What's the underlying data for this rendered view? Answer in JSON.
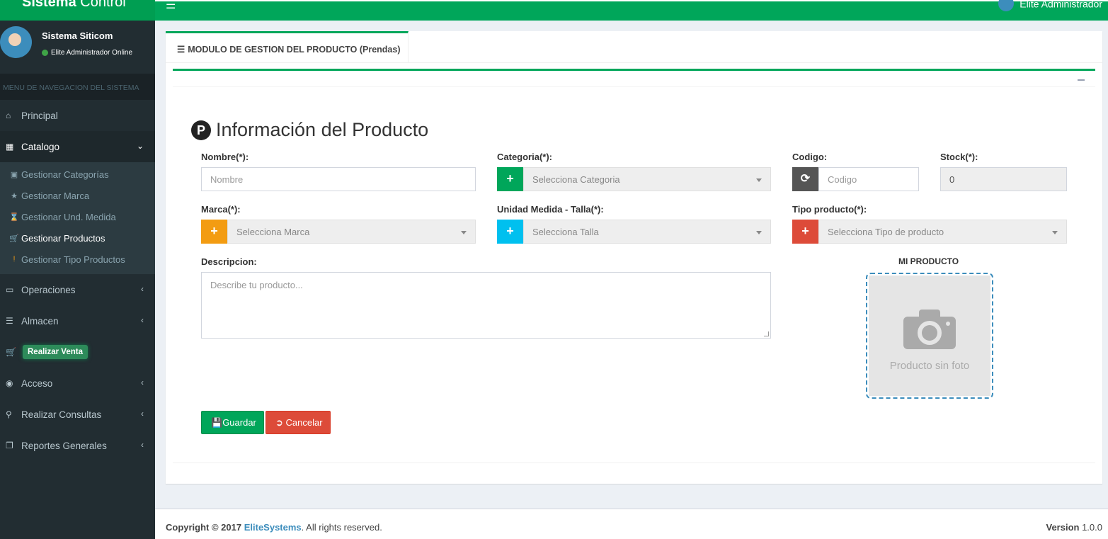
{
  "header": {
    "logo_bold": "Sistema",
    "logo_rest": " Control",
    "menu_icon": "hamburger-icon",
    "user_name": "Elite Administrador"
  },
  "sidebar": {
    "user_name": "Sistema Siticom",
    "user_status": "Elite Administrador Online",
    "section_header": "MENU DE NAVEGACION DEL SISTEMA",
    "items": [
      {
        "label": "Principal",
        "icon": "home-icon"
      },
      {
        "label": "Catalogo",
        "icon": "th-icon"
      },
      {
        "label": "Operaciones",
        "icon": "laptop-icon"
      },
      {
        "label": "Almacen",
        "icon": "database-icon"
      },
      {
        "label": "Realizar Venta",
        "icon": "cart-icon"
      },
      {
        "label": "Acceso",
        "icon": "lock-icon"
      },
      {
        "label": "Realizar Consultas",
        "icon": "search-icon"
      },
      {
        "label": "Reportes Generales",
        "icon": "clone-icon"
      }
    ],
    "catalogo_sub": [
      {
        "label": "Gestionar Categorías",
        "icon": "cube-icon"
      },
      {
        "label": "Gestionar Marca",
        "icon": "star-icon"
      },
      {
        "label": "Gestionar Und. Medida",
        "icon": "hourglass-icon"
      },
      {
        "label": "Gestionar Productos",
        "icon": "cart-icon"
      },
      {
        "label": "Gestionar Tipo Productos",
        "icon": "exclamation-icon"
      }
    ]
  },
  "main": {
    "tab_label": "MODULO DE GESTION DEL PRODUCTO (Prendas)",
    "title_badge": "P",
    "title": "Información del Producto",
    "form": {
      "nombre_label": "Nombre(*):",
      "nombre_placeholder": "Nombre",
      "categoria_label": "Categoria(*):",
      "categoria_placeholder": "Selecciona Categoria",
      "codigo_label": "Codigo:",
      "codigo_placeholder": "Codigo",
      "stock_label": "Stock(*):",
      "stock_value": "0",
      "marca_label": "Marca(*):",
      "marca_placeholder": "Selecciona Marca",
      "unidad_label": "Unidad Medida - Talla(*):",
      "unidad_placeholder": "Selecciona Talla",
      "tipo_label": "Tipo producto(*):",
      "tipo_placeholder": "Selecciona Tipo de producto",
      "descripcion_label": "Descripcion:",
      "descripcion_placeholder": "Describe tu producto...",
      "photo_label": "MI PRODUCTO",
      "photo_text": "Producto sin foto"
    },
    "buttons": {
      "save": "Guardar",
      "cancel": "Cancelar"
    },
    "colors": {
      "green": "#00a65a",
      "orange": "#f39c12",
      "cyan": "#00c0ef",
      "red": "#dd4b39",
      "gray": "#555555"
    }
  },
  "footer": {
    "copyright": "Copyright © 2017 ",
    "company": "EliteSystems",
    "rights": ". All rights reserved.",
    "version_label": "Version",
    "version_value": " 1.0.0"
  }
}
